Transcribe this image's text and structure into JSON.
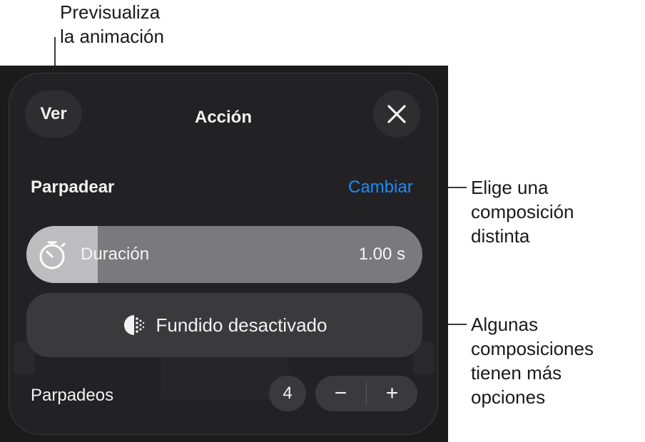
{
  "annotations": {
    "preview": "Previsualiza\nla animación",
    "change": "Elige una\ncomposición\ndistinta",
    "options": "Algunas\ncomposiciones\ntienen más\nopciones"
  },
  "header": {
    "view_label": "Ver",
    "title": "Acción",
    "close_icon": "close-icon"
  },
  "effect": {
    "name": "Parpadear",
    "change_label": "Cambiar"
  },
  "duration": {
    "icon": "stopwatch-icon",
    "label": "Duración",
    "value": "1.00 s",
    "progress_fraction": 0.18
  },
  "fade": {
    "icon": "fade-icon",
    "label": "Fundido desactivado"
  },
  "blinks": {
    "label": "Parpadeos",
    "count": "4",
    "minus": "−",
    "plus": "+"
  },
  "colors": {
    "accent": "#1a8cff",
    "panel": "#222224",
    "background": "#1b1b1c"
  }
}
